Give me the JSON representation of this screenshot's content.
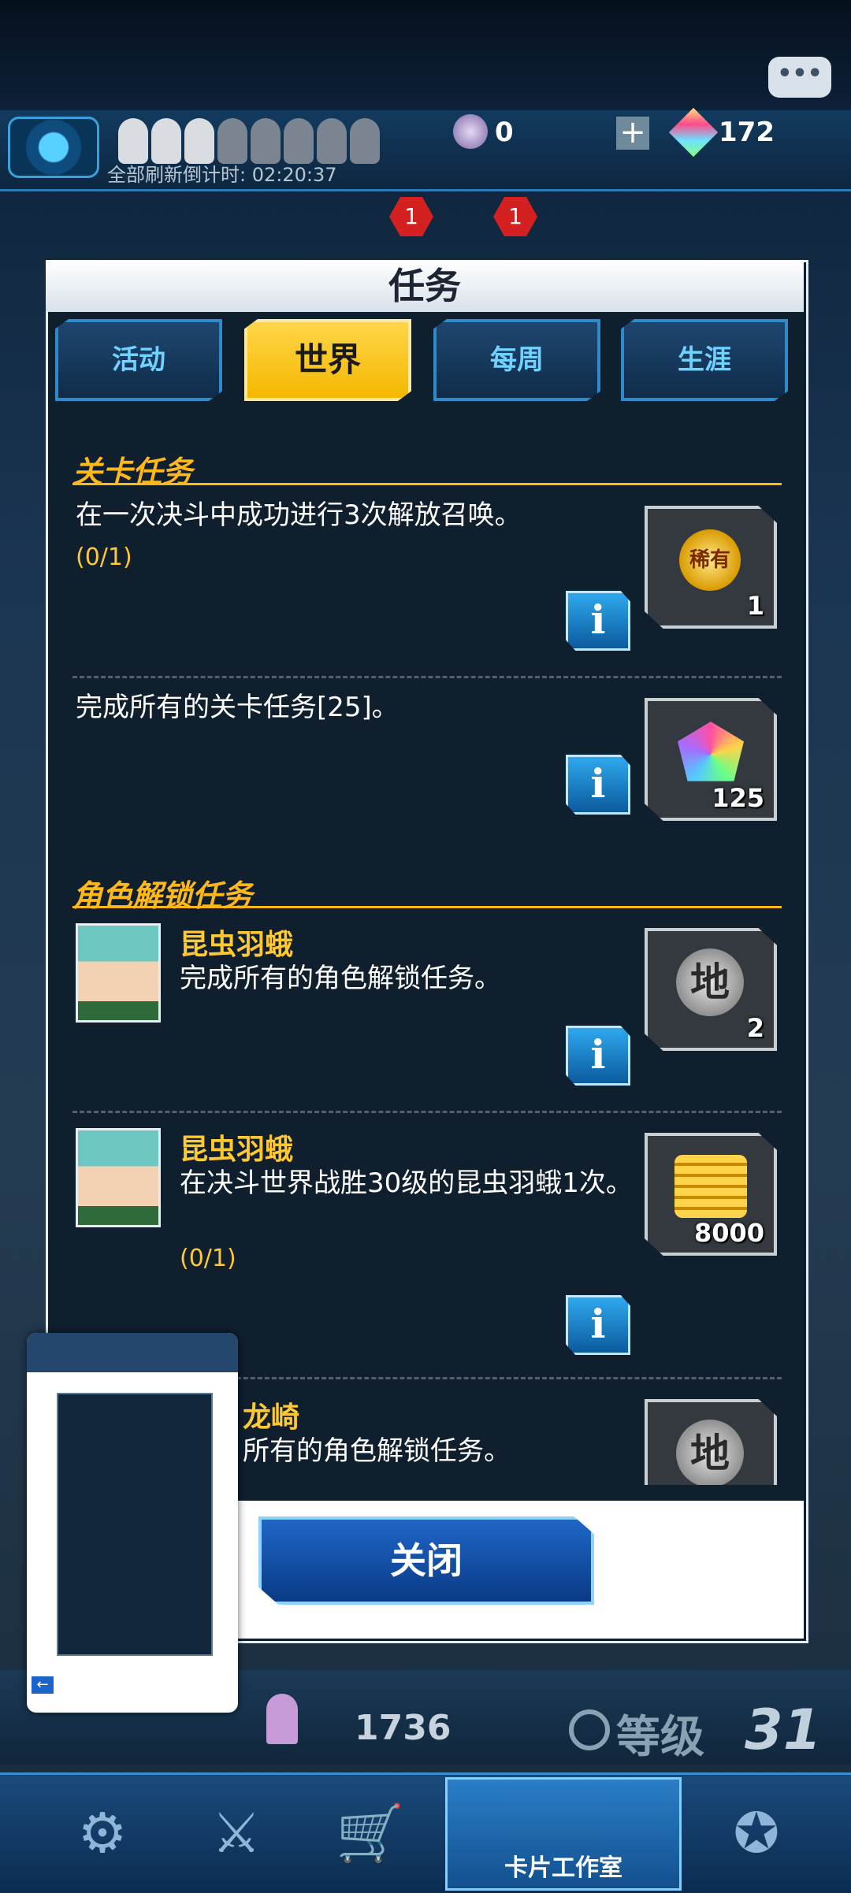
{
  "hud": {
    "refresh_countdown": "全部刷新倒计时: 02:20:37",
    "coin_value": "0",
    "gem_value": "172",
    "badge_1": "1",
    "badge_2": "1"
  },
  "dialog": {
    "title": "任务",
    "tabs": [
      {
        "label": "活动",
        "active": false
      },
      {
        "label": "世界",
        "active": true
      },
      {
        "label": "每周",
        "active": false
      },
      {
        "label": "生涯",
        "active": false
      }
    ],
    "sections": [
      {
        "heading": "关卡任务",
        "missions": [
          {
            "desc": "在一次决斗中成功进行3次解放召唤。",
            "progress": "(0/1)",
            "reward_icon": "rare-medal-icon",
            "reward_text": "稀有",
            "reward_qty": "1"
          },
          {
            "desc": "完成所有的关卡任务[25]。",
            "reward_icon": "crystal-gem-icon",
            "reward_qty": "125"
          }
        ]
      },
      {
        "heading": "角色解锁任务",
        "missions": [
          {
            "character": "昆虫羽蛾",
            "desc": "完成所有的角色解锁任务。",
            "reward_icon": "earth-attribute-icon",
            "reward_text": "地",
            "reward_qty": "2"
          },
          {
            "character": "昆虫羽蛾",
            "desc": "在决斗世界战胜30级的昆虫羽蛾1次。",
            "progress": "(0/1)",
            "reward_icon": "gold-coins-icon",
            "reward_qty": "8000"
          },
          {
            "character": "龙崎",
            "desc": "所有的角色解锁任务。",
            "reward_icon": "earth-attribute-icon",
            "reward_text": "地"
          }
        ]
      }
    ],
    "close_label": "关闭"
  },
  "bottom": {
    "count": "1736",
    "level_label": "等级",
    "level_value": "31",
    "nav_center_label": "卡片工作室"
  },
  "colors": {
    "accent_gold": "#ffb81c",
    "tab_active": "#ffd54a",
    "tab_inactive_text": "#6fd2ff",
    "panel_bg": "#0f1f2e"
  }
}
